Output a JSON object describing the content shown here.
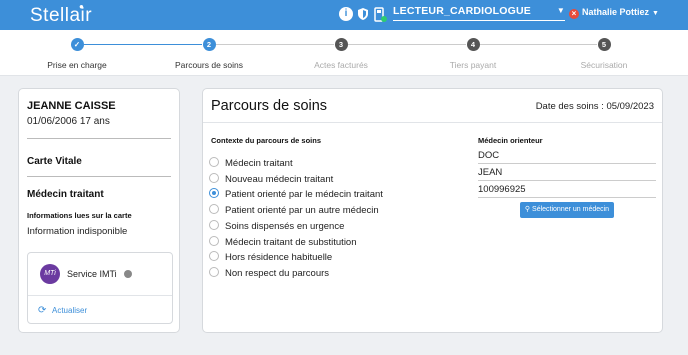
{
  "app": {
    "logo": "Stellair"
  },
  "topbar": {
    "reader": "LECTEUR_CARDIOLOGUE",
    "user": "Nathalie Pottiez",
    "icons": [
      "info-icon",
      "shield-icon",
      "card-reader-icon"
    ]
  },
  "stepper": {
    "steps": [
      {
        "label": "Prise en charge",
        "num": "✓",
        "state": "done"
      },
      {
        "label": "Parcours de soins",
        "num": "2",
        "state": "active"
      },
      {
        "label": "Actes facturés",
        "num": "3",
        "state": "todo"
      },
      {
        "label": "Tiers payant",
        "num": "4",
        "state": "todo"
      },
      {
        "label": "Sécurisation",
        "num": "5",
        "state": "todo"
      }
    ]
  },
  "patient": {
    "name": "JEANNE CAISSE",
    "dob": "01/06/2006 17 ans",
    "carte_vitale": "Carte Vitale",
    "medecin_traitant": "Médecin traitant",
    "info_title": "Informations lues sur la carte",
    "info_value": "Information indisponible"
  },
  "imti": {
    "label": "Service IMTi",
    "logo_text": "MTi",
    "refresh": "Actualiser"
  },
  "parcours": {
    "title": "Parcours de soins",
    "date": "Date des soins : 05/09/2023",
    "context_title": "Contexte du parcours de soins",
    "options": [
      {
        "label": "Médecin traitant",
        "checked": false
      },
      {
        "label": "Nouveau médecin traitant",
        "checked": false
      },
      {
        "label": "Patient orienté par le médecin traitant",
        "checked": true
      },
      {
        "label": "Patient orienté par un autre médecin",
        "checked": false
      },
      {
        "label": "Soins dispensés en urgence",
        "checked": false
      },
      {
        "label": "Médecin traitant de substitution",
        "checked": false
      },
      {
        "label": "Hors résidence habituelle",
        "checked": false
      },
      {
        "label": "Non respect du parcours",
        "checked": false
      }
    ]
  },
  "orienteur": {
    "title": "Médecin orienteur",
    "nom": "DOC",
    "prenom": "JEAN",
    "numero": "100996925",
    "button": "Sélectionner un médecin"
  },
  "colors": {
    "brand": "#3d8fd9",
    "imti": "#6b3aa0",
    "error": "#e74c3c"
  }
}
